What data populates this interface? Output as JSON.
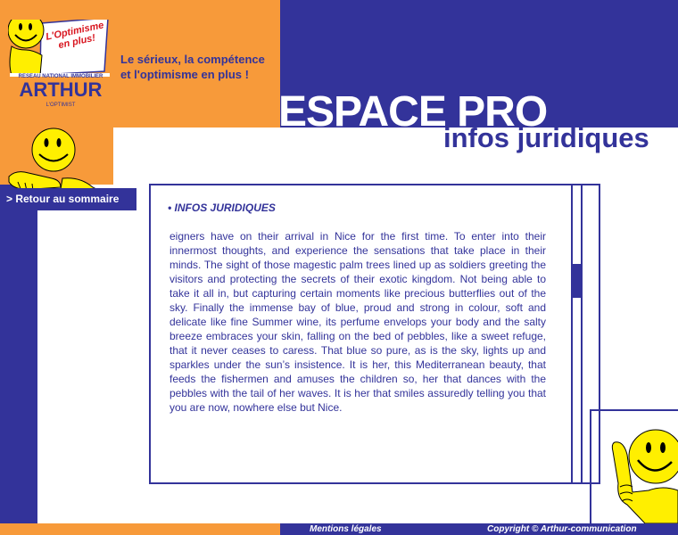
{
  "logo": {
    "slogan": "L'Optimisme en plus!",
    "network": "RESEAU NATIONAL IMMOBILIER",
    "brand": "ARTHUR",
    "sub": "L'OPTIMIST"
  },
  "tagline": "Le sérieux, la compétence et l'optimisme en plus !",
  "header": {
    "title": "ESPACE PRO",
    "subtitle": "infos juridiques"
  },
  "nav": {
    "back": "> Retour au sommaire"
  },
  "content": {
    "heading": "• INFOS JURIDIQUES",
    "body": "eigners have on their arrival in Nice for the first time. To enter into their innermost thoughts, and experience the sensations that take place in their minds. The sight of those magestic palm trees lined up as soldiers greeting the visitors and protecting the secrets of their exotic kingdom. Not being able to take it all in, but capturing certain moments like precious butterflies out of the sky. Finally the immense bay of blue, proud and strong in colour, soft and delicate like fine Summer wine, its perfume envelops your body and the salty breeze embraces your skin, falling on the bed of pebbles, like a sweet refuge, that it never ceases to caress. That blue so pure, as is the sky, lights up and sparkles under the sun’s insistence. It is her, this Mediterranean beauty, that feeds the fishermen and amuses the children so, her that dances with the pebbles with the tail of her waves. It is her that smiles assuredly telling you that you are now, nowhere else but Nice."
  },
  "footer": {
    "legal": "Mentions légales",
    "copyright": "Copyright © Arthur-communication"
  },
  "colors": {
    "brand_blue": "#33339a",
    "brand_orange": "#f79a3a",
    "mascot_yellow": "#ffef00",
    "slogan_red": "#d8141e"
  },
  "icons": [
    "smiley-mascot-icon",
    "smiley-mascot-icon",
    "smiley-mascot-icon"
  ]
}
